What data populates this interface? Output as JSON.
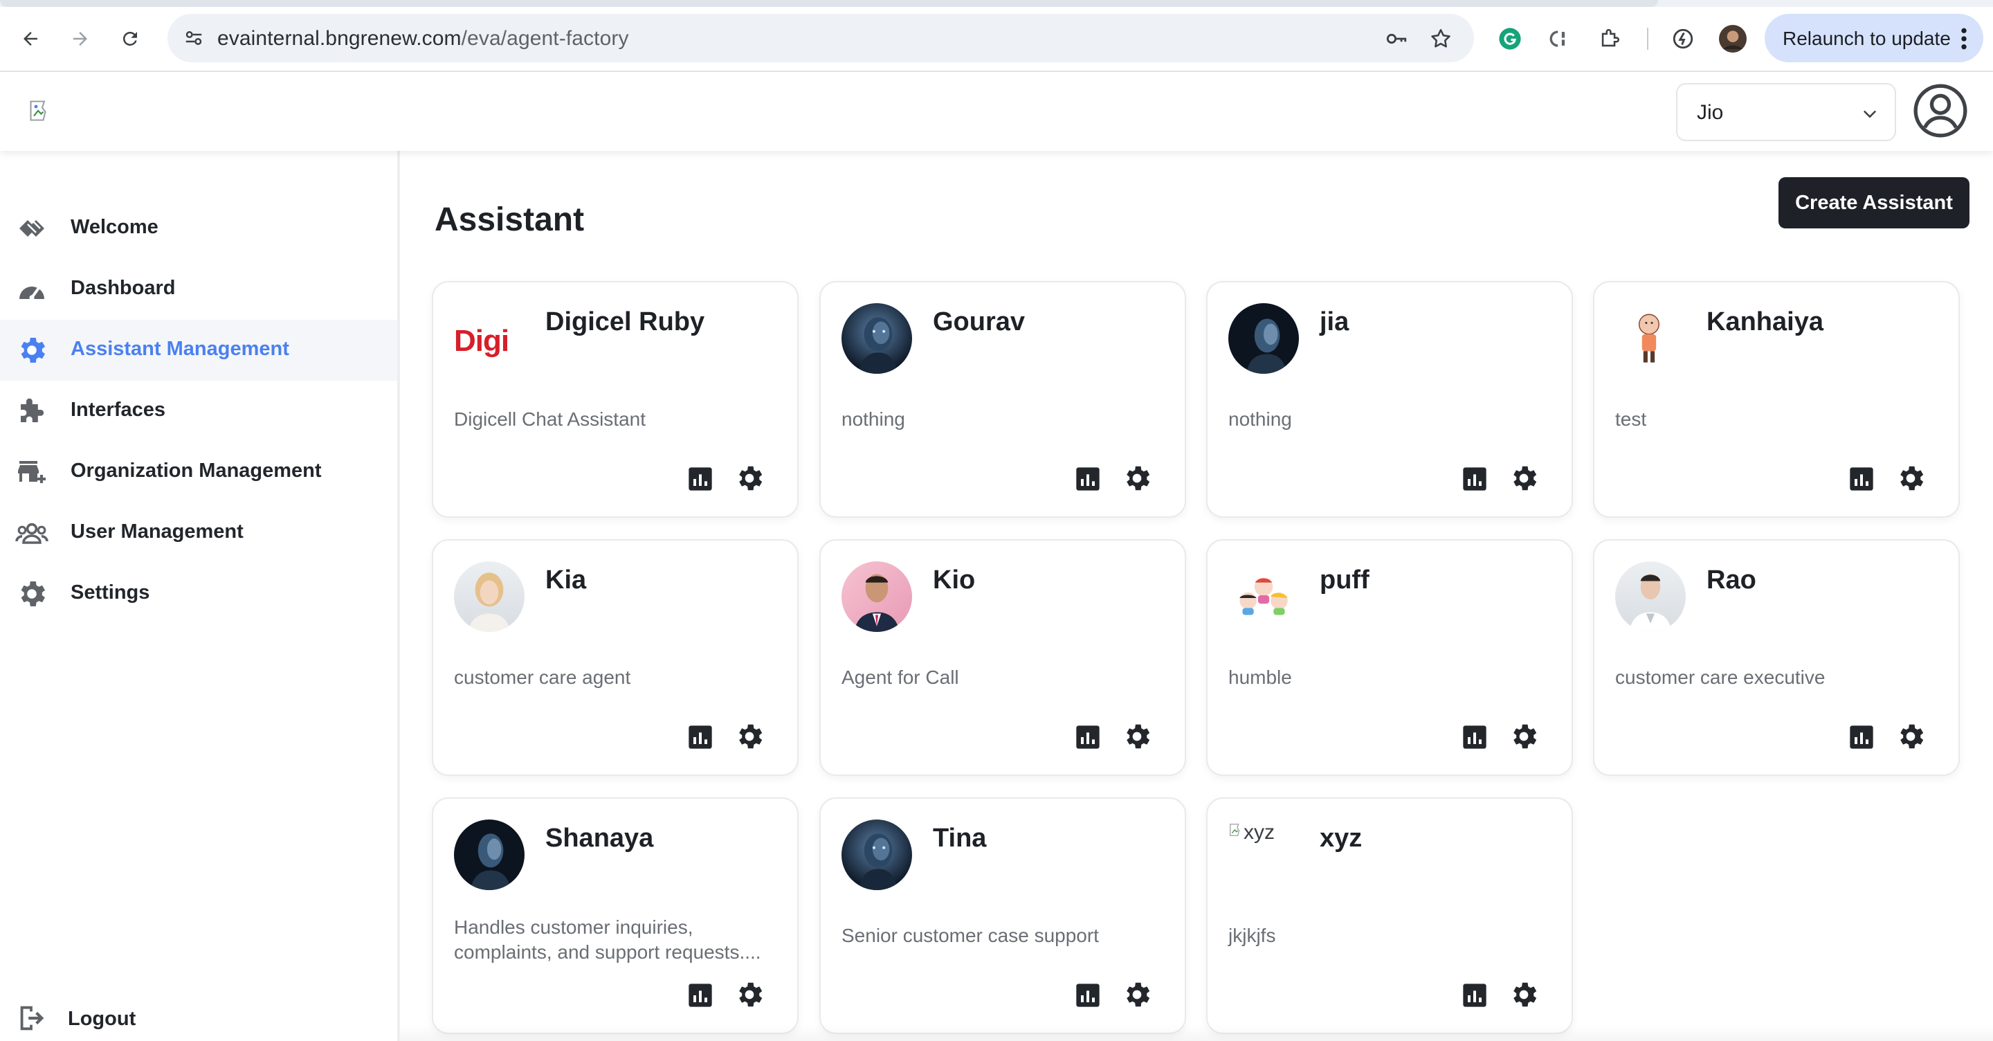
{
  "browser": {
    "url_host": "evainternal.bngrenew.com",
    "url_path": "/eva/agent-factory",
    "relaunch_label": "Relaunch to update"
  },
  "header": {
    "org_selected": "Jio"
  },
  "sidebar": {
    "items": [
      {
        "label": "Welcome",
        "icon": "welcome-icon"
      },
      {
        "label": "Dashboard",
        "icon": "dashboard-icon"
      },
      {
        "label": "Assistant Management",
        "icon": "gear-icon",
        "active": true
      },
      {
        "label": "Interfaces",
        "icon": "puzzle-icon"
      },
      {
        "label": "Organization Management",
        "icon": "store-add-icon"
      },
      {
        "label": "User Management",
        "icon": "users-icon"
      },
      {
        "label": "Settings",
        "icon": "settings-icon"
      }
    ],
    "logout_label": "Logout"
  },
  "main": {
    "title": "Assistant",
    "create_button": "Create Assistant",
    "assistants": [
      {
        "name": "Digicel Ruby",
        "description": "Digicell Chat Assistant",
        "avatar": "digicel-logo"
      },
      {
        "name": "Gourav",
        "description": "nothing",
        "avatar": "robot-dark"
      },
      {
        "name": "jia",
        "description": "nothing",
        "avatar": "robot-dark"
      },
      {
        "name": "Kanhaiya",
        "description": "test",
        "avatar": "cartoon-boy"
      },
      {
        "name": "Kia",
        "description": "customer care agent",
        "avatar": "woman-blonde"
      },
      {
        "name": "Kio",
        "description": "Agent for Call",
        "avatar": "man-suit"
      },
      {
        "name": "puff",
        "description": "humble",
        "avatar": "cartoon-girls"
      },
      {
        "name": "Rao",
        "description": "customer care executive",
        "avatar": "doctor-woman"
      },
      {
        "name": "Shanaya",
        "description": "Handles customer inquiries, complaints, and support requests....",
        "avatar": "robot-dark"
      },
      {
        "name": "Tina",
        "description": "Senior customer case support",
        "avatar": "robot-dark"
      },
      {
        "name": "xyz",
        "description": "jkjkjfs",
        "avatar": "broken-image",
        "avatar_alt": "xyz"
      }
    ],
    "digicel_logo_text": "Digi"
  },
  "colors": {
    "accent": "#4a80f0",
    "primary_button": "#1e2228",
    "relaunch_bg": "#d6e2fb"
  }
}
